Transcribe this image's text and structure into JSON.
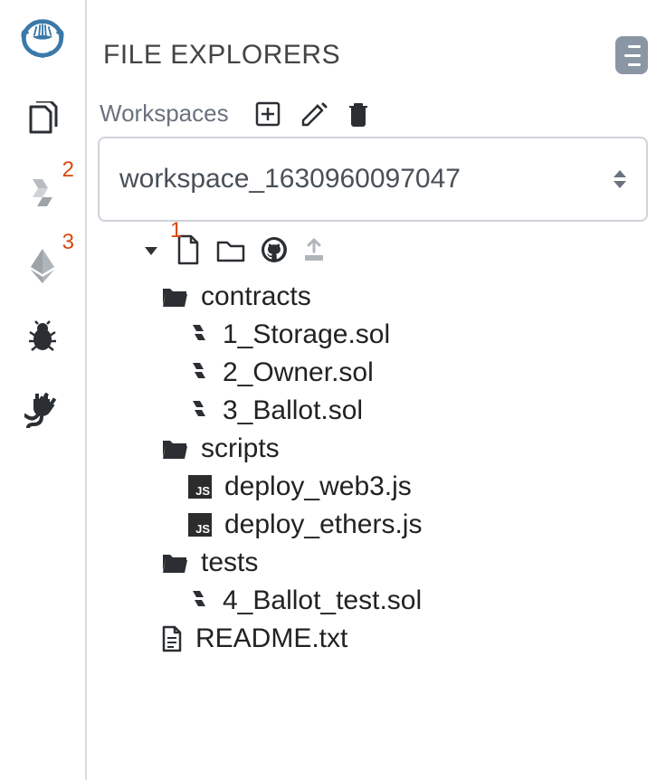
{
  "panel": {
    "title": "FILE EXPLORERS",
    "workspaces_label": "Workspaces",
    "selected_workspace": "workspace_1630960097047"
  },
  "sidebar": {
    "items": [
      {
        "name": "file-explorer",
        "badge": null
      },
      {
        "name": "compiler",
        "badge": "2"
      },
      {
        "name": "deploy",
        "badge": "3"
      },
      {
        "name": "debugger",
        "badge": null
      },
      {
        "name": "plugin-manager",
        "badge": null
      }
    ]
  },
  "toolbar": {
    "badge": "1"
  },
  "tree": [
    {
      "type": "folder",
      "open": true,
      "depth": 1,
      "label": "contracts"
    },
    {
      "type": "sol",
      "depth": 2,
      "label": "1_Storage.sol"
    },
    {
      "type": "sol",
      "depth": 2,
      "label": "2_Owner.sol"
    },
    {
      "type": "sol",
      "depth": 2,
      "label": "3_Ballot.sol"
    },
    {
      "type": "folder",
      "open": true,
      "depth": 1,
      "label": "scripts"
    },
    {
      "type": "js",
      "depth": 2,
      "label": "deploy_web3.js"
    },
    {
      "type": "js",
      "depth": 2,
      "label": "deploy_ethers.js"
    },
    {
      "type": "folder",
      "open": true,
      "depth": 1,
      "label": "tests"
    },
    {
      "type": "sol",
      "depth": 2,
      "label": "4_Ballot_test.sol"
    },
    {
      "type": "txt",
      "depth": 1,
      "label": "README.txt"
    }
  ]
}
